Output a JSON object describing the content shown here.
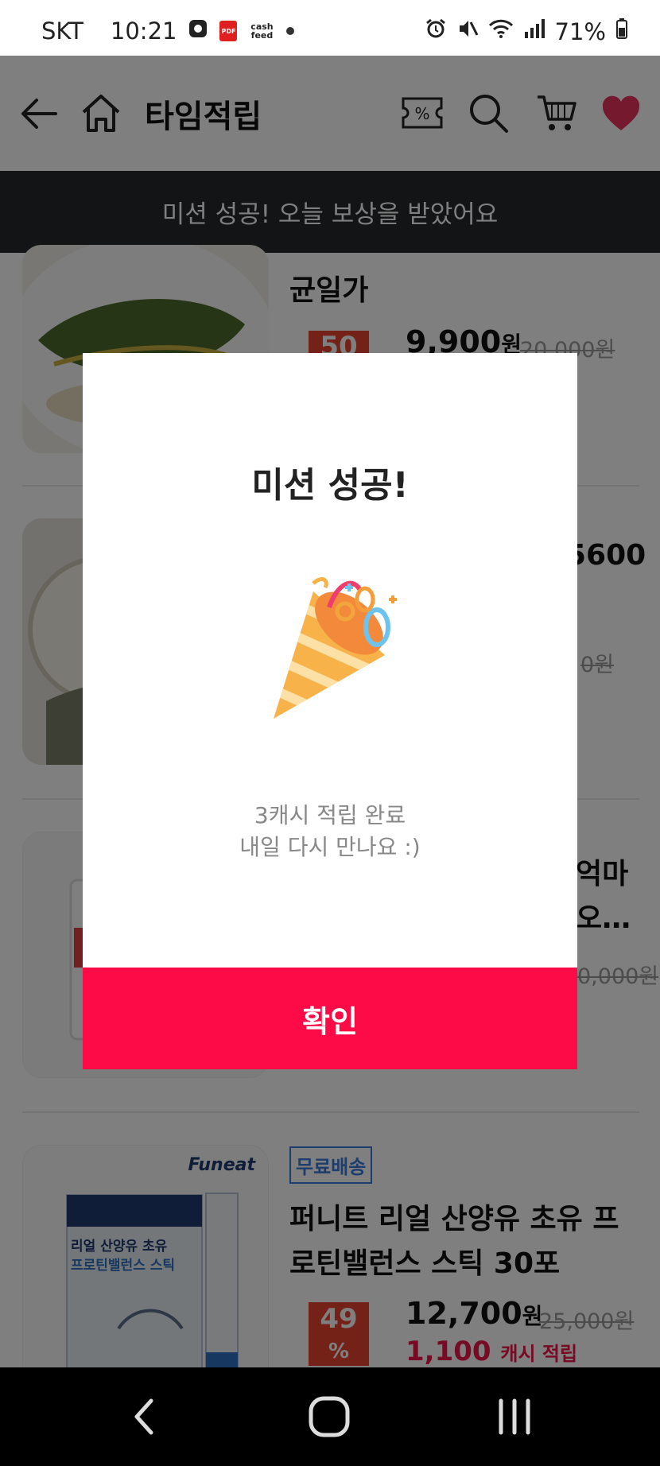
{
  "status_bar": {
    "carrier": "SKT",
    "time": "10:21",
    "pdf_badge": "PDF",
    "cashfeed_badge": "cash feed",
    "battery": "71%"
  },
  "header": {
    "title": "타임적립"
  },
  "toast": {
    "text": "미션 성공! 오늘 보상을 받았어요"
  },
  "products": [
    {
      "title_partial": "균일가",
      "discount": "50",
      "price": "9,900",
      "price_unit": "원",
      "original_price": "20,000",
      "original_unit": "원"
    },
    {
      "title_partial": "5600",
      "original_partial": "0",
      "original_unit": "원"
    },
    {
      "title_partial_1": "억마",
      "title_partial_2": "오…",
      "original_partial": "0,000",
      "original_unit": "원"
    },
    {
      "brand": "Funeat",
      "badge": "무료배송",
      "title_line1": "퍼니트 리얼 산양유 초유 프",
      "title_line2": "로틴밸런스 스틱 30포",
      "discount": "49",
      "discount_unit": "%",
      "price": "12,700",
      "price_unit": "원",
      "original_price": "25,000",
      "original_unit": "원",
      "cash_amount": "1,100",
      "cash_label": "캐시 적립",
      "box_label_1": "리얼 산양유 초유",
      "box_label_2": "프로틴밸런스 스틱"
    }
  ],
  "dialog": {
    "title": "미션 성공!",
    "message_line1": "3캐시 적립 완료",
    "message_line2": "내일 다시 만나요 :)",
    "confirm_label": "확인"
  },
  "colors": {
    "accent": "#fc0b47",
    "heart": "#e8335c",
    "toast_bg": "#26282c",
    "discount": "#e9442f",
    "cash": "#ef1448"
  }
}
